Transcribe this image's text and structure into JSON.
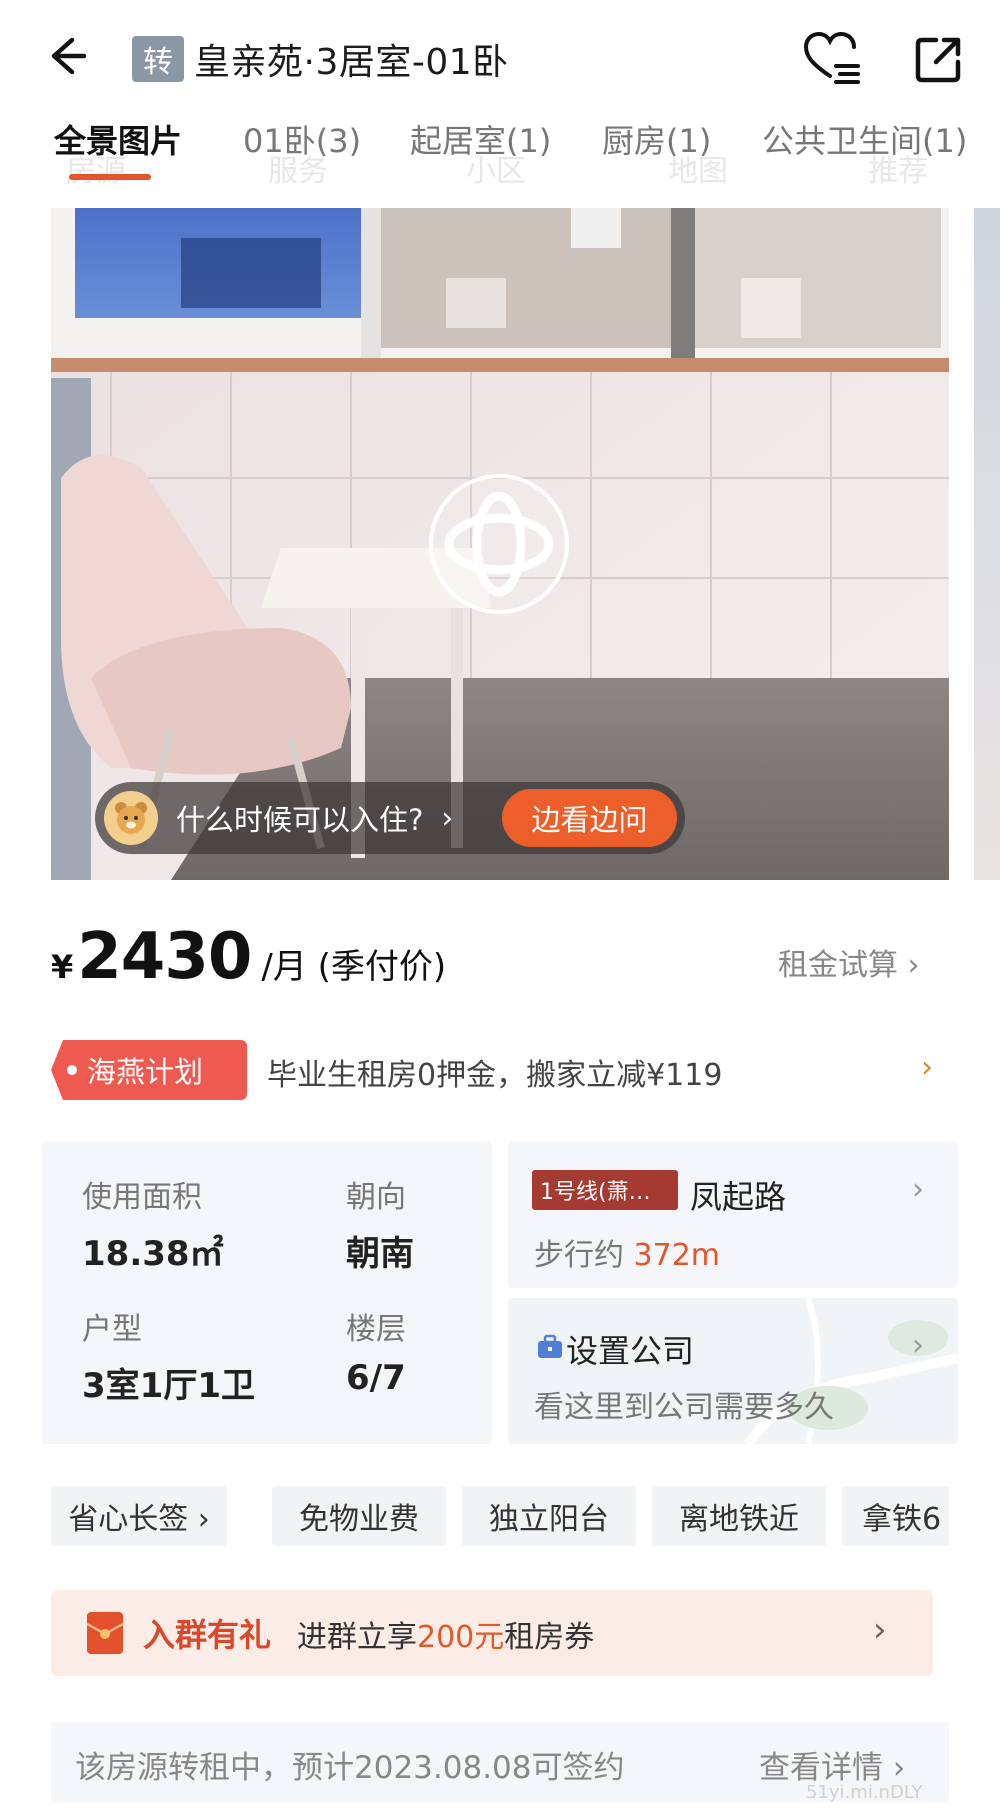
{
  "header": {
    "badge": "转",
    "title": "皇亲苑·3居室-01卧",
    "icons": {
      "back": "back-arrow-icon",
      "favorite": "heart-list-icon",
      "share": "share-icon"
    }
  },
  "tabs": [
    {
      "label": "全景图片",
      "active": true
    },
    {
      "label": "01卧(3)",
      "active": false
    },
    {
      "label": "起居室(1)",
      "active": false
    },
    {
      "label": "厨房(1)",
      "active": false
    },
    {
      "label": "公共卫生间(1)",
      "active": false
    }
  ],
  "ghost_tabs": [
    "房源",
    "服务",
    "小区",
    "地图",
    "推荐"
  ],
  "photo": {
    "ask_text": "什么时候可以入住?",
    "ask_button": "边看边问"
  },
  "price": {
    "currency": "¥",
    "amount": "2430",
    "unit": "/月 (季付价)",
    "calc_link": "租金试算 ›"
  },
  "promo": {
    "tag": "海燕计划",
    "text": "毕业生租房0押金，搬家立减¥119",
    "arrow": "›"
  },
  "info": {
    "area_label": "使用面积",
    "area_value": "18.38㎡",
    "orientation_label": "朝向",
    "orientation_value": "朝南",
    "layout_label": "户型",
    "layout_value": "3室1厅1卫",
    "floor_label": "楼层",
    "floor_value": "6/7"
  },
  "metro": {
    "line": "1号线(萧…",
    "station": "凤起路",
    "walk_label": "步行约 ",
    "walk_distance": "372m"
  },
  "company": {
    "title": "设置公司",
    "subtitle": "看这里到公司需要多久"
  },
  "feature_tags": [
    "省心长签 ›",
    "免物业费",
    "独立阳台",
    "离地铁近",
    "拿铁6"
  ],
  "group_banner": {
    "title": "入群有礼",
    "text_prefix": "进群立享",
    "amount": "200元",
    "text_suffix": "租房券",
    "arrow": "›"
  },
  "notice": {
    "text": "该房源转租中，预计2023.08.08可签约",
    "link": "查看详情 ›"
  },
  "watermark": "51yi.mi.nDLY",
  "colors": {
    "accent": "#e8552c",
    "promo_red": "#ee5a4f",
    "metro_badge": "#a53a33",
    "badge_gray": "#8a97a6",
    "panel_bg": "#f4f6f9"
  }
}
